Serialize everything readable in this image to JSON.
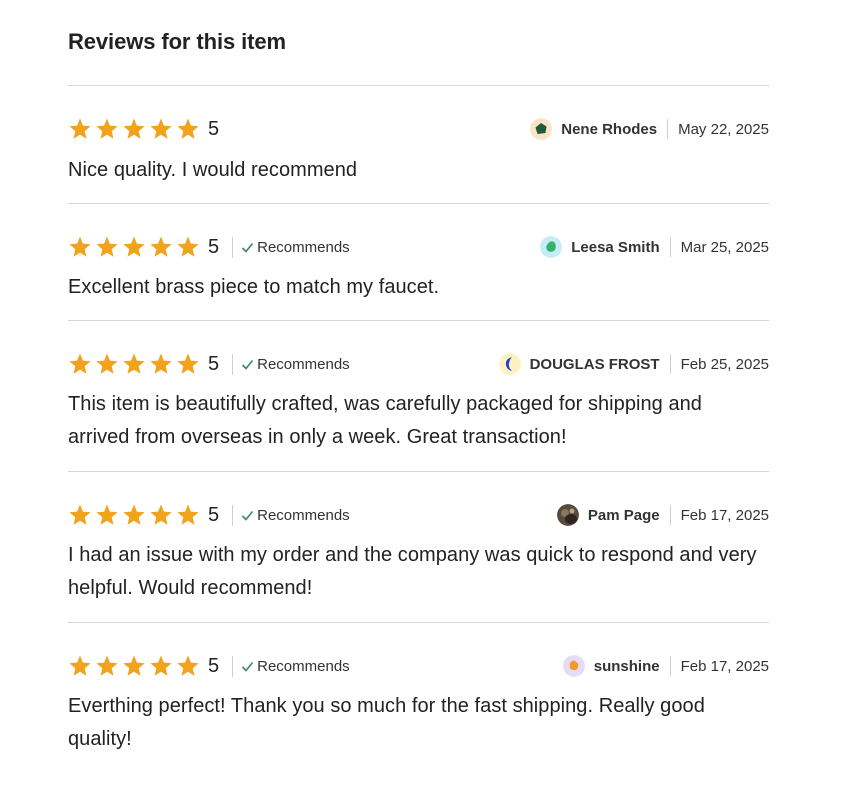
{
  "page": {
    "title": "Reviews for this item"
  },
  "colors": {
    "star": "#f1a31d",
    "divider": "#d6d6d6",
    "check": "#3d8a5f"
  },
  "reviews": [
    {
      "rating": 5,
      "stars_filled": 5,
      "rating_label": "5",
      "recommends_label": "",
      "reviewer_name": "Nene Rhodes",
      "date": "May 22, 2025",
      "avatar_icon": "green-hexagon-avatar-icon",
      "text": "Nice quality. I would recommend"
    },
    {
      "rating": 5,
      "stars_filled": 5,
      "rating_label": "5",
      "recommends_label": "Recommends",
      "reviewer_name": "Leesa Smith",
      "date": "Mar 25, 2025",
      "avatar_icon": "green-blob-avatar-icon",
      "text": "Excellent brass piece to match my faucet."
    },
    {
      "rating": 5,
      "stars_filled": 5,
      "rating_label": "5",
      "recommends_label": "Recommends",
      "reviewer_name": "DOUGLAS FROST",
      "date": "Feb 25, 2025",
      "avatar_icon": "blue-crescent-avatar-icon",
      "text": "This item is beautifully crafted, was carefully packaged for shipping and arrived from overseas in only a week. Great transaction!"
    },
    {
      "rating": 5,
      "stars_filled": 5,
      "rating_label": "5",
      "recommends_label": "Recommends",
      "reviewer_name": "Pam Page",
      "date": "Feb 17, 2025",
      "avatar_icon": "photo-avatar-icon",
      "text": "I had an issue with my order and the company was quick to respond and very helpful. Would recommend!"
    },
    {
      "rating": 5,
      "stars_filled": 5,
      "rating_label": "5",
      "recommends_label": "Recommends",
      "reviewer_name": "sunshine",
      "date": "Feb 17, 2025",
      "avatar_icon": "orange-blob-avatar-icon",
      "text": "Everthing perfect! Thank you so much for the fast shipping. Really good quality!"
    }
  ]
}
